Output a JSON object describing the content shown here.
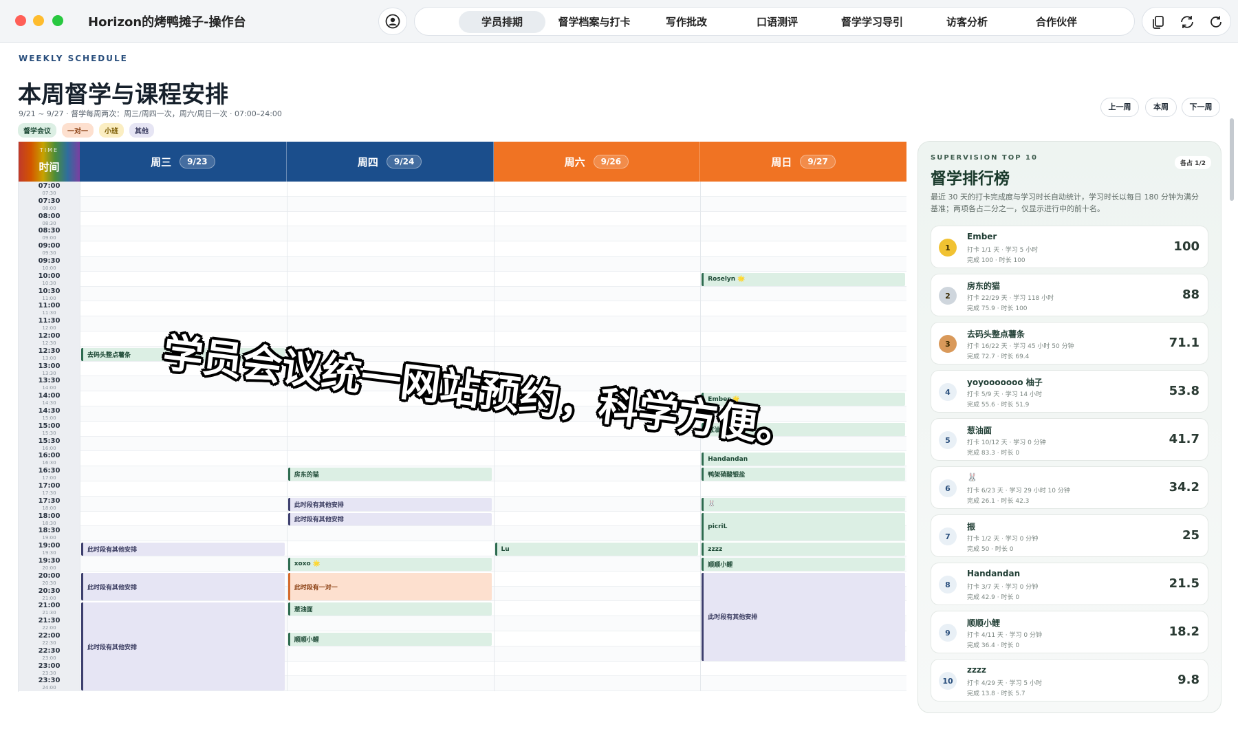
{
  "window": {
    "title": "Horizon的烤鸭摊子-操作台",
    "traffic_colors": [
      "#ff5f57",
      "#febc2e",
      "#28c840"
    ]
  },
  "nav": {
    "tabs": [
      "学员排期",
      "督学档案与打卡",
      "写作批改",
      "口语测评",
      "督学学习导引",
      "访客分析",
      "合作伙伴"
    ],
    "active_index": 0
  },
  "tools": [
    "copy-icon",
    "sync-icon",
    "refresh-icon"
  ],
  "schedule": {
    "eyebrow": "WEEKLY SCHEDULE",
    "title": "本周督学与课程安排",
    "subtitle": "9/21 ~ 9/27 · 督学每周两次：周三/周四一次，周六/周日一次 · 07:00–24:00",
    "legend": [
      {
        "label": "督学会议",
        "bg": "#dcefe4",
        "fg": "#1e4a36"
      },
      {
        "label": "一对一",
        "bg": "#fde0cf",
        "fg": "#8a3f12"
      },
      {
        "label": "小班",
        "bg": "#fbeec2",
        "fg": "#7a5a00"
      },
      {
        "label": "其他",
        "bg": "#e6e5f4",
        "fg": "#3a3c60"
      }
    ],
    "week_buttons": [
      "上一周",
      "本周",
      "下一周"
    ],
    "time_header_small": "TIME",
    "time_header": "时间",
    "days": [
      {
        "name": "周三",
        "date": "9/23",
        "color": "#1b4e8c"
      },
      {
        "name": "周四",
        "date": "9/24",
        "color": "#1b4e8c"
      },
      {
        "name": "周六",
        "date": "9/26",
        "color": "#f07323"
      },
      {
        "name": "周日",
        "date": "9/27",
        "color": "#f07323"
      }
    ],
    "slots": [
      [
        "07:00",
        "07:30"
      ],
      [
        "07:30",
        "08:00"
      ],
      [
        "08:00",
        "08:30"
      ],
      [
        "08:30",
        "09:00"
      ],
      [
        "09:00",
        "09:30"
      ],
      [
        "09:30",
        "10:00"
      ],
      [
        "10:00",
        "10:30"
      ],
      [
        "10:30",
        "11:00"
      ],
      [
        "11:00",
        "11:30"
      ],
      [
        "11:30",
        "12:00"
      ],
      [
        "12:00",
        "12:30"
      ],
      [
        "12:30",
        "13:00"
      ],
      [
        "13:00",
        "13:30"
      ],
      [
        "13:30",
        "14:00"
      ],
      [
        "14:00",
        "14:30"
      ],
      [
        "14:30",
        "15:00"
      ],
      [
        "15:00",
        "15:30"
      ],
      [
        "15:30",
        "16:00"
      ],
      [
        "16:00",
        "16:30"
      ],
      [
        "16:30",
        "17:00"
      ],
      [
        "17:00",
        "17:30"
      ],
      [
        "17:30",
        "18:00"
      ],
      [
        "18:00",
        "18:30"
      ],
      [
        "18:30",
        "19:00"
      ],
      [
        "19:00",
        "19:30"
      ],
      [
        "19:30",
        "20:00"
      ],
      [
        "20:00",
        "20:30"
      ],
      [
        "20:30",
        "21:00"
      ],
      [
        "21:00",
        "21:30"
      ],
      [
        "21:30",
        "22:00"
      ],
      [
        "22:00",
        "22:30"
      ],
      [
        "22:30",
        "23:00"
      ],
      [
        "23:00",
        "23:30"
      ],
      [
        "23:30",
        "24:00"
      ]
    ],
    "events": [
      {
        "day": 0,
        "start": "12:30",
        "end": "13:00",
        "label": "去码头整点薯条",
        "kind": "green"
      },
      {
        "day": 0,
        "start": "19:00",
        "end": "19:30",
        "label": "此时段有其他安排",
        "kind": "purple"
      },
      {
        "day": 0,
        "start": "20:00",
        "end": "21:00",
        "label": "此时段有其他安排",
        "kind": "purple"
      },
      {
        "day": 0,
        "start": "21:00",
        "end": "24:00",
        "label": "此时段有其他安排",
        "kind": "purple"
      },
      {
        "day": 1,
        "start": "16:30",
        "end": "17:00",
        "label": "房东的猫",
        "kind": "green"
      },
      {
        "day": 1,
        "start": "17:30",
        "end": "18:00",
        "label": "此时段有其他安排",
        "kind": "purple"
      },
      {
        "day": 1,
        "start": "18:00",
        "end": "18:30",
        "label": "此时段有其他安排",
        "kind": "purple"
      },
      {
        "day": 1,
        "start": "19:30",
        "end": "20:00",
        "label": "xoxo 🌟",
        "kind": "green"
      },
      {
        "day": 1,
        "start": "20:00",
        "end": "21:00",
        "label": "此时段有一对一",
        "kind": "orange"
      },
      {
        "day": 1,
        "start": "21:00",
        "end": "21:30",
        "label": "葱油面",
        "kind": "green"
      },
      {
        "day": 1,
        "start": "22:00",
        "end": "22:30",
        "label": "顺顺小鲤",
        "kind": "green"
      },
      {
        "day": 2,
        "start": "19:00",
        "end": "19:30",
        "label": "Lu",
        "kind": "green"
      },
      {
        "day": 3,
        "start": "10:00",
        "end": "10:30",
        "label": "Roselyn 🌟",
        "kind": "green"
      },
      {
        "day": 3,
        "start": "14:00",
        "end": "14:30",
        "label": "Ember 🌟",
        "kind": "green"
      },
      {
        "day": 3,
        "start": "15:00",
        "end": "15:30",
        "label": "葱油面",
        "kind": "green"
      },
      {
        "day": 3,
        "start": "16:00",
        "end": "16:30",
        "label": "Handandan",
        "kind": "green"
      },
      {
        "day": 3,
        "start": "16:30",
        "end": "17:00",
        "label": "鸭架硝酸银盐",
        "kind": "green"
      },
      {
        "day": 3,
        "start": "17:30",
        "end": "18:00",
        "label": "🐰",
        "kind": "green"
      },
      {
        "day": 3,
        "start": "18:00",
        "end": "19:00",
        "label": "picriL",
        "kind": "green"
      },
      {
        "day": 3,
        "start": "19:00",
        "end": "19:30",
        "label": "zzzz",
        "kind": "green"
      },
      {
        "day": 3,
        "start": "19:30",
        "end": "20:00",
        "label": "顺顺小鲤",
        "kind": "green"
      },
      {
        "day": 3,
        "start": "20:00",
        "end": "23:00",
        "label": "此时段有其他安排",
        "kind": "purple"
      }
    ]
  },
  "overlay_caption": "学员会议统一网站预约，科学方便。",
  "leaderboard": {
    "eyebrow": "SUPERVISION TOP 10",
    "title": "督学排行榜",
    "pill": "各占 1/2",
    "description": "最近 30 天的打卡完成度与学习时长自动统计，学习时长以每日 180 分钟为满分基准；两项各占二分之一，仅显示进行中的前十名。",
    "items": [
      {
        "rank": "1",
        "name": "Ember",
        "line1": "打卡 1/1 天 · 学习 5 小时",
        "line2": "完成 100 · 时长 100",
        "score": "100"
      },
      {
        "rank": "2",
        "name": "房东的猫",
        "line1": "打卡 22/29 天 · 学习 118 小时",
        "line2": "完成 75.9 · 时长 100",
        "score": "88"
      },
      {
        "rank": "3",
        "name": "去码头整点薯条",
        "line1": "打卡 16/22 天 · 学习 45 小时 50 分钟",
        "line2": "完成 72.7 · 时长 69.4",
        "score": "71.1"
      },
      {
        "rank": "4",
        "name": "yoyooooooo 柚子",
        "line1": "打卡 5/9 天 · 学习 14 小时",
        "line2": "完成 55.6 · 时长 51.9",
        "score": "53.8"
      },
      {
        "rank": "5",
        "name": "葱油面",
        "line1": "打卡 10/12 天 · 学习 0 分钟",
        "line2": "完成 83.3 · 时长 0",
        "score": "41.7"
      },
      {
        "rank": "6",
        "name": "🐰",
        "line1": "打卡 6/23 天 · 学习 29 小时 10 分钟",
        "line2": "完成 26.1 · 时长 42.3",
        "score": "34.2"
      },
      {
        "rank": "7",
        "name": "振",
        "line1": "打卡 1/2 天 · 学习 0 分钟",
        "line2": "完成 50 · 时长 0",
        "score": "25"
      },
      {
        "rank": "8",
        "name": "Handandan",
        "line1": "打卡 3/7 天 · 学习 0 分钟",
        "line2": "完成 42.9 · 时长 0",
        "score": "21.5"
      },
      {
        "rank": "9",
        "name": "顺顺小鲤",
        "line1": "打卡 4/11 天 · 学习 0 分钟",
        "line2": "完成 36.4 · 时长 0",
        "score": "18.2"
      },
      {
        "rank": "10",
        "name": "zzzz",
        "line1": "打卡 4/29 天 · 学习 5 小时",
        "line2": "完成 13.8 · 时长 5.7",
        "score": "9.8"
      }
    ]
  }
}
